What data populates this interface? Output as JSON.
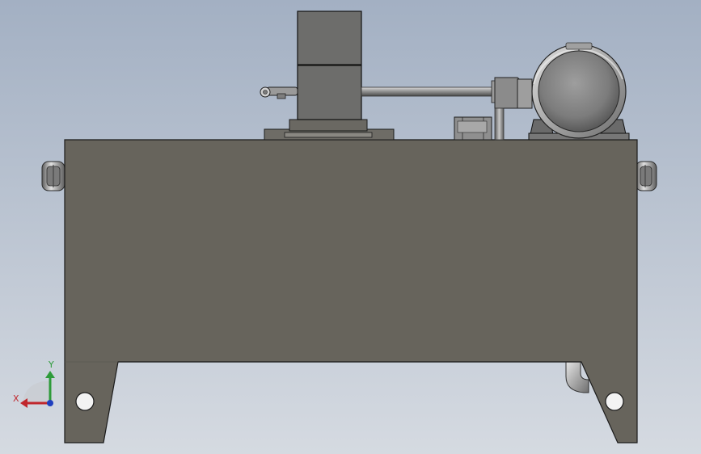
{
  "viewport": {
    "background_top": "#a4b1c4",
    "background_bottom": "#d4d9e0"
  },
  "model": {
    "tank_color": "#67645c",
    "edge_color": "#1e1e1e",
    "metal_color": "#a9aaa9"
  },
  "triad": {
    "x_label": "X",
    "y_label": "Y",
    "x_color": "#c0272d",
    "y_color": "#2e9b3a",
    "z_color": "#1f3fbf"
  }
}
